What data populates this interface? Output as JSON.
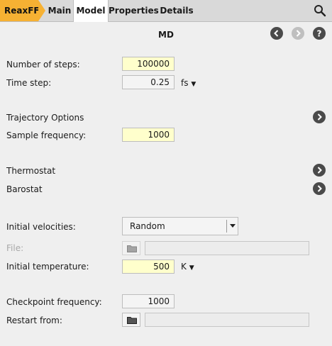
{
  "colors": {
    "accent": "#f6b133",
    "field_highlight": "#ffffcc",
    "nav_button": "#4a4a4a",
    "nav_button_disabled": "#bfbfbf"
  },
  "breadcrumb": {
    "root": "ReaxFF"
  },
  "tabs": [
    "Main",
    "Model",
    "Properties",
    "Details"
  ],
  "active_tab": "Model",
  "panel": {
    "title": "MD"
  },
  "icons": {
    "search": "search-icon",
    "back": "chevron-left-icon",
    "forward": "chevron-right-icon",
    "help": "question-icon",
    "expand": "chevron-right-icon",
    "folder": "folder-icon"
  },
  "fields": {
    "steps": {
      "label": "Number of steps:",
      "value": "100000"
    },
    "timestep": {
      "label": "Time step:",
      "value": "0.25",
      "unit": "fs"
    },
    "trajectory": {
      "label": "Trajectory Options"
    },
    "sample": {
      "label": "Sample frequency:",
      "value": "1000"
    },
    "thermostat": {
      "label": "Thermostat"
    },
    "barostat": {
      "label": "Barostat"
    },
    "velocities": {
      "label": "Initial velocities:",
      "value": "Random"
    },
    "file": {
      "label": "File:",
      "value": ""
    },
    "temperature": {
      "label": "Initial temperature:",
      "value": "500",
      "unit": "K"
    },
    "checkpoint": {
      "label": "Checkpoint frequency:",
      "value": "1000"
    },
    "restart": {
      "label": "Restart from:",
      "value": ""
    }
  }
}
